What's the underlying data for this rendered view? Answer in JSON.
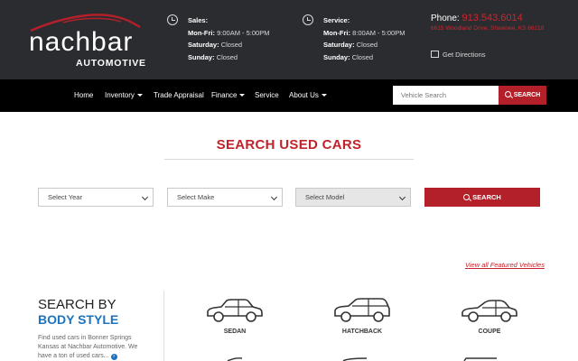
{
  "logo": {
    "brand": "nachbar",
    "subtitle": "AUTOMOTIVE"
  },
  "sales_hours": {
    "title": "Sales:",
    "rows": [
      {
        "day": "Mon-Fri:",
        "time": "9:00AM - 5:00PM"
      },
      {
        "day": "Saturday:",
        "time": "Closed"
      },
      {
        "day": "Sunday:",
        "time": "Closed"
      }
    ]
  },
  "service_hours": {
    "title": "Service:",
    "rows": [
      {
        "day": "Mon-Fri:",
        "time": "8:00AM - 5:00PM"
      },
      {
        "day": "Saturday:",
        "time": "Closed"
      },
      {
        "day": "Sunday:",
        "time": "Closed"
      }
    ]
  },
  "contact": {
    "phone_label": "Phone:",
    "phone": "913.543.6014",
    "address": "6615 Woodland Drive, Shawnee, KS 66218",
    "directions": "Get Directions"
  },
  "nav": {
    "items": [
      "Home",
      "Inventory",
      "Trade Appraisal",
      "Finance",
      "Service",
      "About Us"
    ],
    "search_placeholder": "Vehicle Search",
    "search_button": "SEARCH"
  },
  "main": {
    "title": "SEARCH USED CARS",
    "filters": {
      "year": "Select Year",
      "make": "Select Make",
      "model": "Select Model"
    },
    "search_button": "SEARCH",
    "featured_link": "View all Featured Vehicles"
  },
  "body_style": {
    "heading_line1": "SEARCH BY",
    "heading_line2": "BODY STYLE",
    "description": "Find used cars in Bonner Springs Kansas at Nachbar Automotive. We have a ton of used cars...",
    "types": [
      "SEDAN",
      "HATCHBACK",
      "COUPE"
    ]
  },
  "colors": {
    "header_bg": "#2b2c30",
    "nav_bg": "#000000",
    "accent_red": "#b4202a",
    "link_blue": "#1e73be"
  }
}
